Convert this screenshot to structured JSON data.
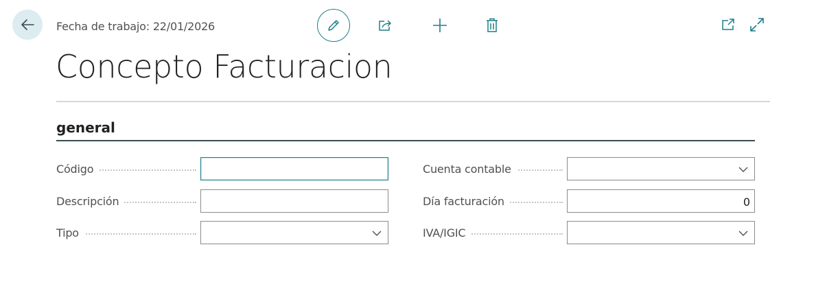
{
  "header": {
    "work_date_label": "Fecha de trabajo: 22/01/2026",
    "accent_color": "#1a7f8a"
  },
  "page": {
    "title": "Concepto Facturacion"
  },
  "section": {
    "title": "general"
  },
  "fields": {
    "codigo": {
      "label": "Código",
      "value": ""
    },
    "descripcion": {
      "label": "Descripción",
      "value": ""
    },
    "tipo": {
      "label": "Tipo",
      "value": ""
    },
    "cuenta": {
      "label": "Cuenta contable",
      "value": ""
    },
    "dia": {
      "label": "Día facturación",
      "value": "0"
    },
    "iva": {
      "label": "IVA/IGIC",
      "value": ""
    }
  }
}
